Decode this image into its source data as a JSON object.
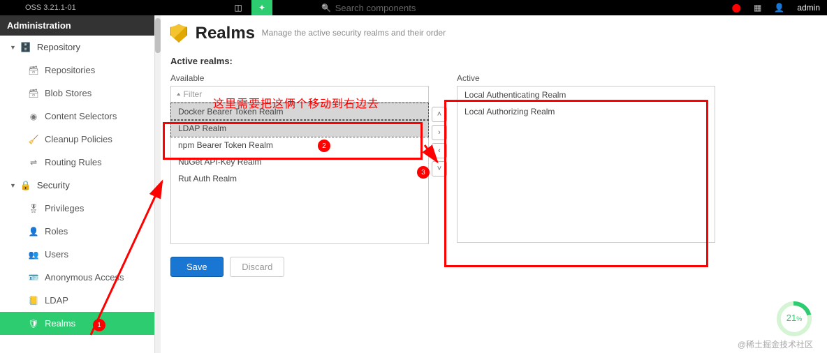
{
  "topbar": {
    "version": "OSS 3.21.1-01",
    "searchPlaceholder": "Search components",
    "username": "admin"
  },
  "sidebar": {
    "heading": "Administration",
    "groups": [
      {
        "label": "Repository",
        "items": [
          {
            "label": "Repositories",
            "icon": "db"
          },
          {
            "label": "Blob Stores",
            "icon": "db"
          },
          {
            "label": "Content Selectors",
            "icon": "tag"
          },
          {
            "label": "Cleanup Policies",
            "icon": "brush"
          },
          {
            "label": "Routing Rules",
            "icon": "route"
          }
        ]
      },
      {
        "label": "Security",
        "items": [
          {
            "label": "Privileges",
            "icon": "badge"
          },
          {
            "label": "Roles",
            "icon": "person"
          },
          {
            "label": "Users",
            "icon": "people"
          },
          {
            "label": "Anonymous Access",
            "icon": "id"
          },
          {
            "label": "LDAP",
            "icon": "book"
          },
          {
            "label": "Realms",
            "icon": "shield",
            "active": true,
            "badge": "1"
          }
        ]
      }
    ]
  },
  "page": {
    "title": "Realms",
    "subtitle": "Manage the active security realms and their order",
    "sectionLabel": "Active realms:",
    "availableLabel": "Available",
    "activeLabel": "Active",
    "filterPlaceholder": "Filter",
    "available": [
      {
        "label": "Docker Bearer Token Realm",
        "selected": true
      },
      {
        "label": "LDAP Realm",
        "selected": true
      },
      {
        "label": "npm Bearer Token Realm",
        "selected": false
      },
      {
        "label": "NuGet API-Key Realm",
        "selected": false
      },
      {
        "label": "Rut Auth Realm",
        "selected": false
      }
    ],
    "active": [
      {
        "label": "Local Authenticating Realm"
      },
      {
        "label": "Local Authorizing Realm"
      }
    ],
    "saveLabel": "Save",
    "discardLabel": "Discard"
  },
  "annotation": {
    "text": "这里需要把这俩个移动到右边去",
    "b2": "2",
    "b3": "3"
  },
  "progress": {
    "value": "21",
    "unit": "%"
  },
  "watermark": "@稀土掘金技术社区"
}
